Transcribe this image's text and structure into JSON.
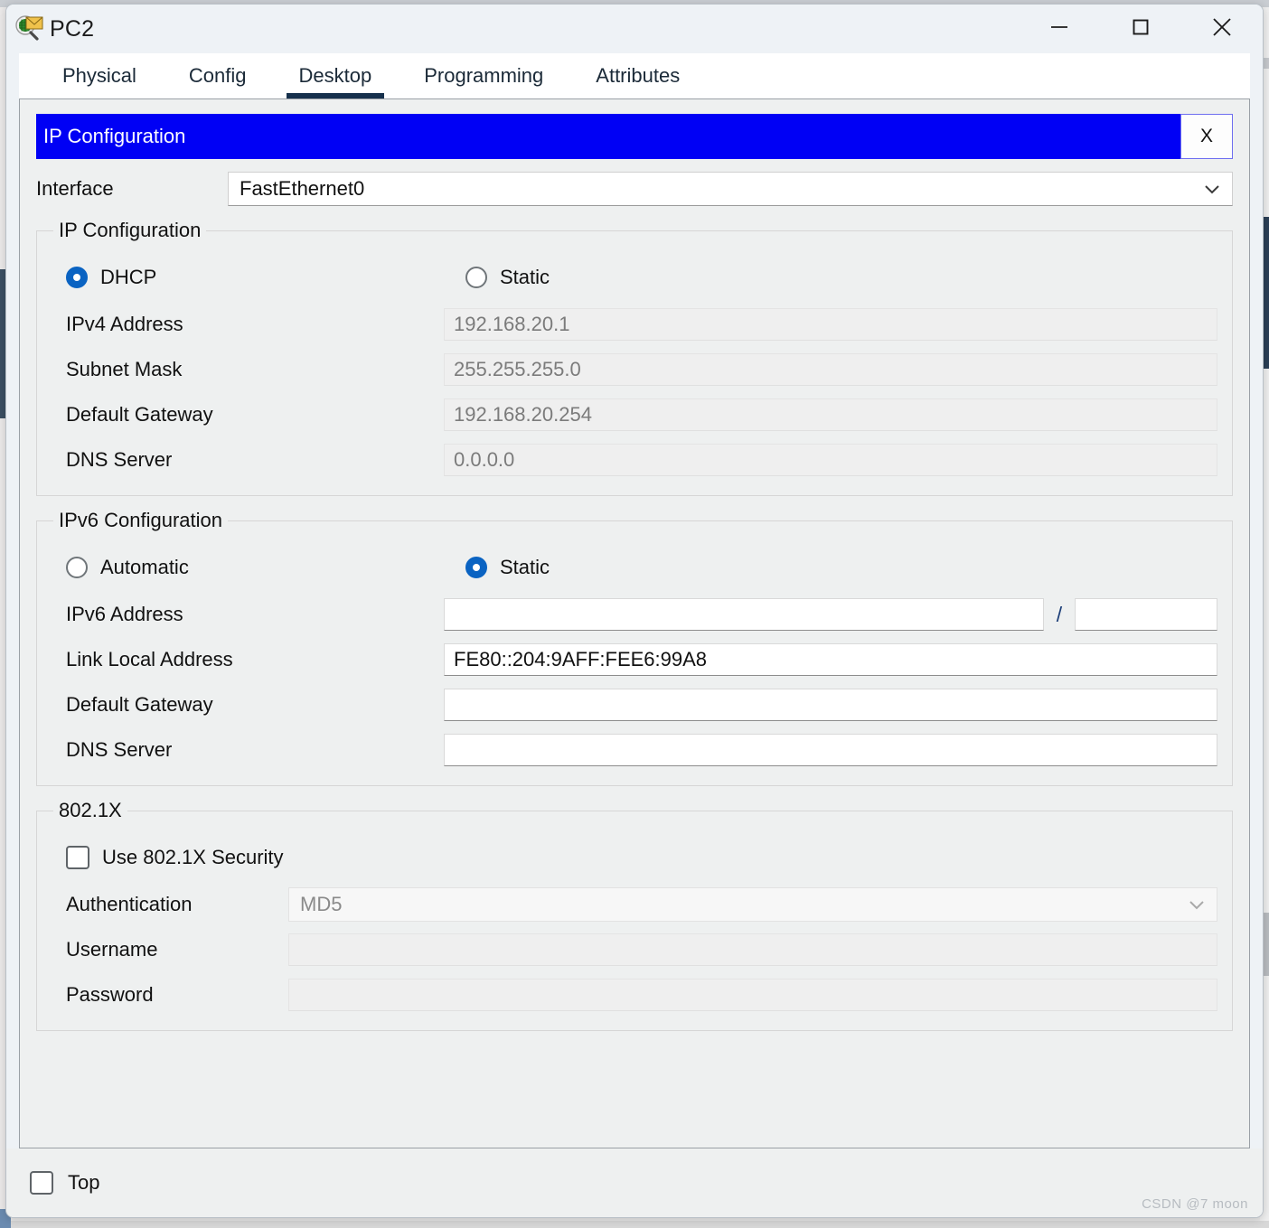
{
  "window": {
    "title": "PC2",
    "icon": "packet-tracer-inspect-icon",
    "controls": {
      "minimize": "minimize-icon",
      "maximize": "maximize-icon",
      "close": "close-icon"
    }
  },
  "tabs": [
    {
      "label": "Physical",
      "active": false
    },
    {
      "label": "Config",
      "active": false
    },
    {
      "label": "Desktop",
      "active": true
    },
    {
      "label": "Programming",
      "active": false
    },
    {
      "label": "Attributes",
      "active": false
    }
  ],
  "banner": {
    "title": "IP Configuration",
    "close_label": "X",
    "background": "#0000f5",
    "text_color": "#ffffff"
  },
  "interface": {
    "label": "Interface",
    "value": "FastEthernet0",
    "chevron": "chevron-down-icon"
  },
  "ip_configuration": {
    "legend": "IP Configuration",
    "mode_dhcp": {
      "label": "DHCP",
      "selected": true
    },
    "mode_static": {
      "label": "Static",
      "selected": false
    },
    "fields": [
      {
        "label": "IPv4 Address",
        "value": "192.168.20.1",
        "disabled": true
      },
      {
        "label": "Subnet Mask",
        "value": "255.255.255.0",
        "disabled": true
      },
      {
        "label": "Default Gateway",
        "value": "192.168.20.254",
        "disabled": true
      },
      {
        "label": "DNS Server",
        "value": "0.0.0.0",
        "disabled": true
      }
    ]
  },
  "ipv6_configuration": {
    "legend": "IPv6 Configuration",
    "mode_automatic": {
      "label": "Automatic",
      "selected": false
    },
    "mode_static": {
      "label": "Static",
      "selected": true
    },
    "address": {
      "label": "IPv6 Address",
      "value": "",
      "prefix": "",
      "separator": "/"
    },
    "link_local": {
      "label": "Link Local Address",
      "value": "FE80::204:9AFF:FEE6:99A8"
    },
    "default_gateway": {
      "label": "Default Gateway",
      "value": ""
    },
    "dns_server": {
      "label": "DNS Server",
      "value": ""
    }
  },
  "security_8021x": {
    "legend": "802.1X",
    "use_security": {
      "label": "Use 802.1X Security",
      "checked": false
    },
    "authentication": {
      "label": "Authentication",
      "value": "MD5",
      "disabled": true,
      "chevron": "chevron-down-icon"
    },
    "username": {
      "label": "Username",
      "value": "",
      "disabled": true
    },
    "password": {
      "label": "Password",
      "value": "",
      "disabled": true
    }
  },
  "footer": {
    "top_checkbox": {
      "label": "Top",
      "checked": false
    }
  },
  "watermark": "CSDN @7 moon"
}
